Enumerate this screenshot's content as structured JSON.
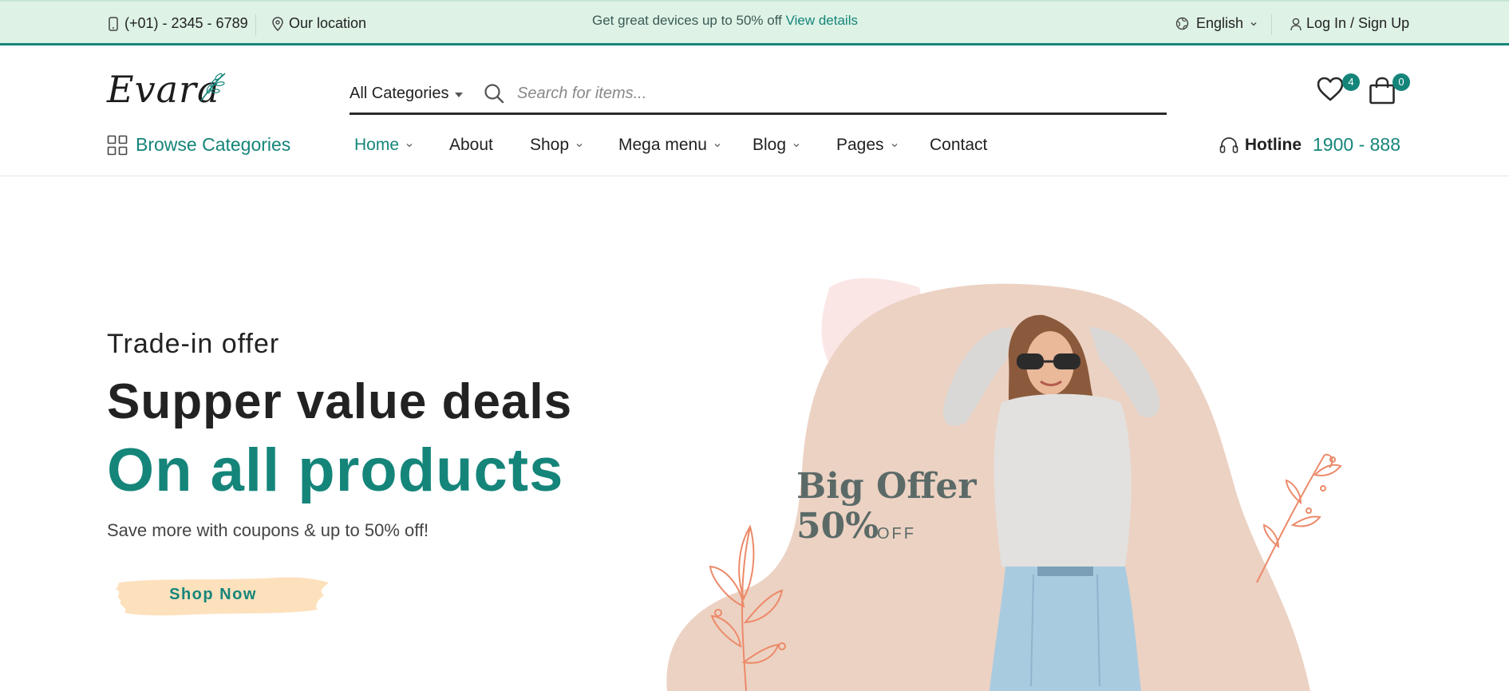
{
  "topbar": {
    "phone": "(+01) - 2345 - 6789",
    "location": "Our location",
    "promo_text": "Get great devices up to 50% off",
    "promo_link": "View details",
    "language": "English",
    "login": "Log In / Sign Up"
  },
  "header": {
    "logo": "Evara",
    "category_select": "All Categories",
    "search_placeholder": "Search for items...",
    "wishlist_count": "4",
    "cart_count": "0"
  },
  "nav": {
    "browse": "Browse Categories",
    "items": [
      {
        "label": "Home",
        "dropdown": true,
        "active": true
      },
      {
        "label": "About",
        "dropdown": false
      },
      {
        "label": "Shop",
        "dropdown": true
      },
      {
        "label": "Mega menu",
        "dropdown": true
      },
      {
        "label": "Blog",
        "dropdown": true
      },
      {
        "label": "Pages",
        "dropdown": true
      },
      {
        "label": "Contact",
        "dropdown": false
      }
    ],
    "hotline_label": "Hotline",
    "hotline_number": "1900 - 888"
  },
  "hero": {
    "subtitle": "Trade-in offer",
    "title": "Supper value deals",
    "title_accent": "On all products",
    "description": "Save more with coupons & up to 50% off!",
    "button": "Shop Now",
    "offer_line1": "Big Offer",
    "offer_percent": "50%",
    "offer_suffix": "OFF"
  },
  "colors": {
    "accent": "#15857a",
    "topbar_bg": "#def2e6",
    "button_bg": "#fde1bd",
    "blob": "#ecd2c3",
    "leaf": "#ec8a6a"
  },
  "icons": [
    "phone-icon",
    "location-pin-icon",
    "globe-icon",
    "user-icon",
    "search-icon",
    "heart-icon",
    "shopping-bag-icon",
    "grid-icon",
    "headset-icon",
    "chevron-down-icon"
  ]
}
